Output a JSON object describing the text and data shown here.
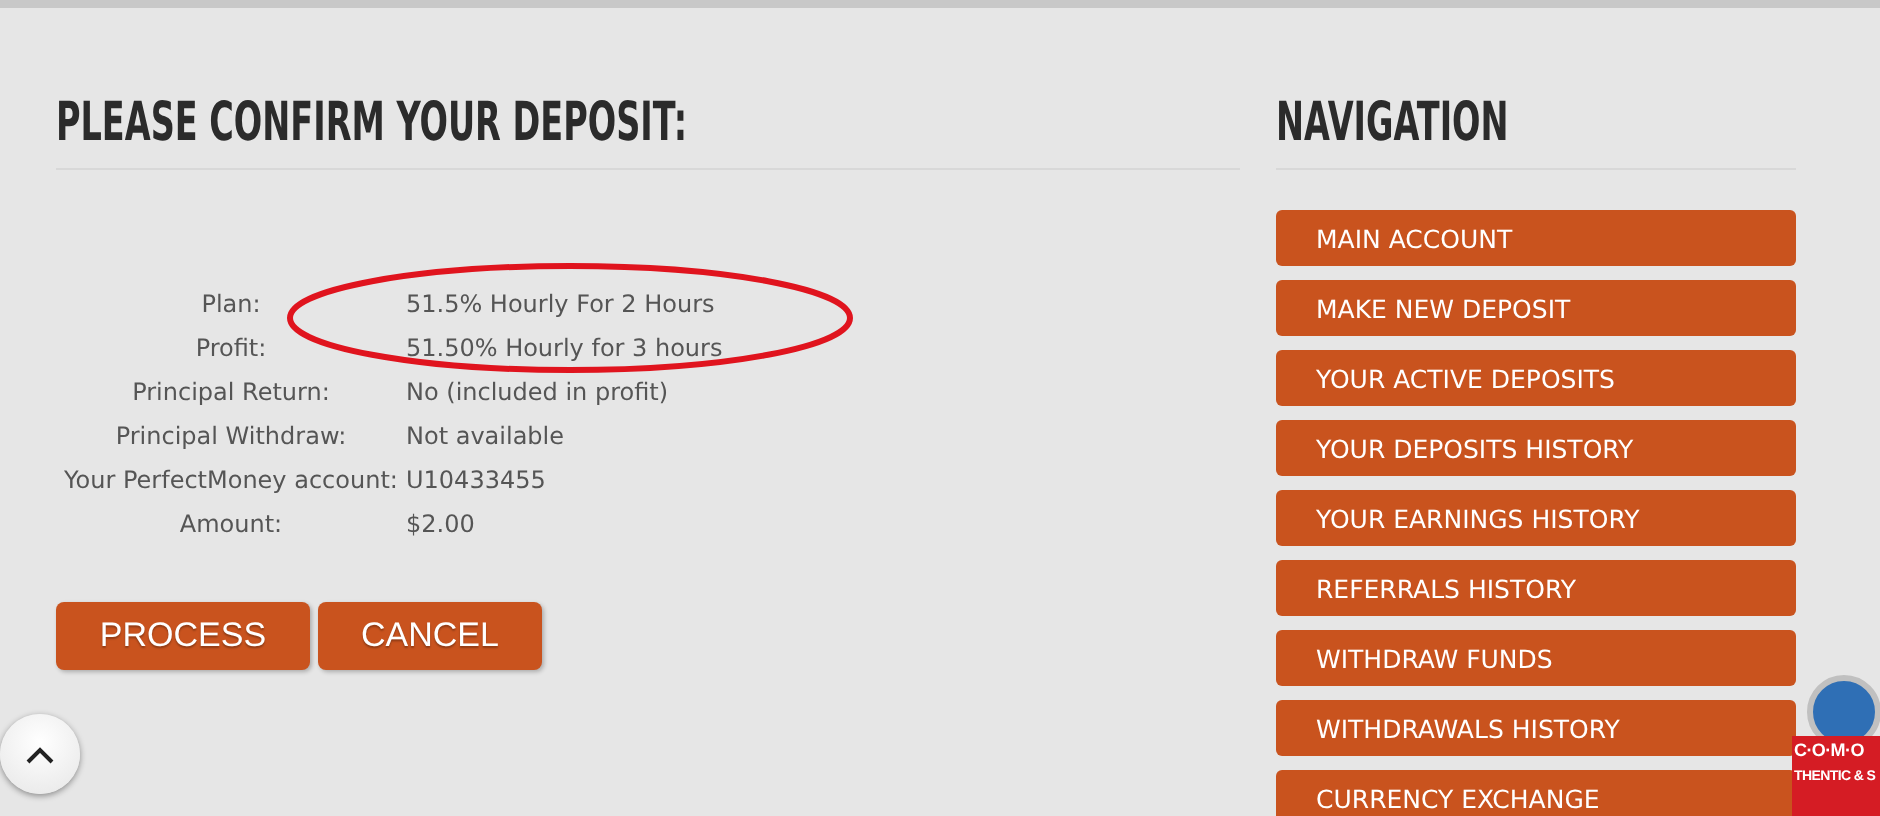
{
  "main": {
    "heading": "PLEASE CONFIRM YOUR DEPOSIT:",
    "details": [
      {
        "label": "Plan:",
        "value": "51.5% Hourly For 2 Hours"
      },
      {
        "label": "Profit:",
        "value": "51.50% Hourly for 3 hours"
      },
      {
        "label": "Principal Return:",
        "value": "No (included in profit)"
      },
      {
        "label": "Principal Withdraw:",
        "value": "Not available"
      },
      {
        "label": "Your PerfectMoney account:",
        "value": "U10433455"
      },
      {
        "label": "Amount:",
        "value": "$2.00"
      }
    ],
    "buttons": [
      "PROCESS",
      "CANCEL"
    ]
  },
  "navigation": {
    "heading": "NAVIGATION",
    "items": [
      "MAIN ACCOUNT",
      "MAKE NEW DEPOSIT",
      "YOUR ACTIVE DEPOSITS",
      "YOUR DEPOSITS HISTORY",
      "YOUR EARNINGS HISTORY",
      "REFERRALS HISTORY",
      "WITHDRAW FUNDS",
      "WITHDRAWALS HISTORY",
      "CURRENCY EXCHANGE"
    ]
  },
  "seal": {
    "brand": "C·O·M·O",
    "caption": "THENTIC & S"
  }
}
